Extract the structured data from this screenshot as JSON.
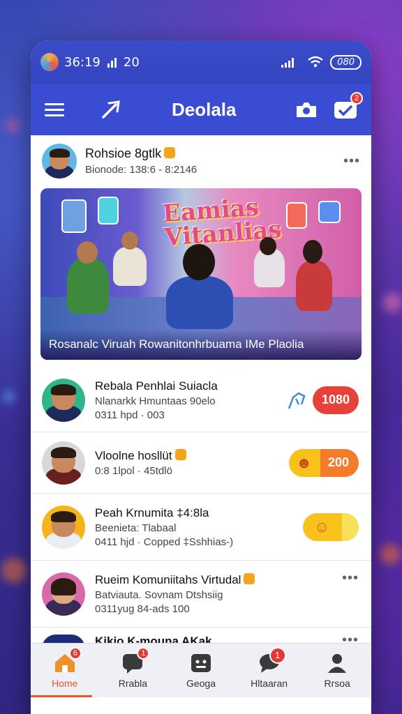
{
  "status_bar": {
    "time": "36:19",
    "network": "20"
  },
  "app_bar": {
    "title": "Deolala",
    "notification_count": "2"
  },
  "post": {
    "author": "Rohsioe 8gtlk",
    "meta": "Bionode: 138:6 - 8:2146",
    "banner_headline_line1": "Eamias",
    "banner_headline_line2": "Vitanlias",
    "banner_caption": "Rosanalc Viruah Rowanitonhrbuama IMe Plaolia"
  },
  "list": [
    {
      "name": "Rebala Penhlai Suiacla",
      "line1": "Nlanarkk Hmuntaas 90elo",
      "line2": "0311 hpd · 003",
      "action_value": "1080",
      "action_color": "#e8413a"
    },
    {
      "name": "Vloolne hosllüt",
      "line1": "0:8 1lpol · 45tdlö",
      "action_value": "200",
      "action_color": "#f37b2a"
    },
    {
      "name": "Peah Krnumita ‡4:8la",
      "line1": "Beenieta: Tlabaal",
      "line2": "0411 hjd · Copped ‡Sshhias-)"
    },
    {
      "name": "Rueim Komuniitahs Virtudal",
      "line1": "Batviauta. Sovnam Dtshsiig",
      "line2": "0311yug 84-ads 100"
    }
  ],
  "peek_item": {
    "name": "Kikio K-mouna AKak"
  },
  "bottom_nav": [
    {
      "label": "Home",
      "badge": "6",
      "active": true
    },
    {
      "label": "Rrabla",
      "badge": "1"
    },
    {
      "label": "Geoga"
    },
    {
      "label": "Hltaaran",
      "badge": "1"
    },
    {
      "label": "Rrsoa"
    }
  ]
}
